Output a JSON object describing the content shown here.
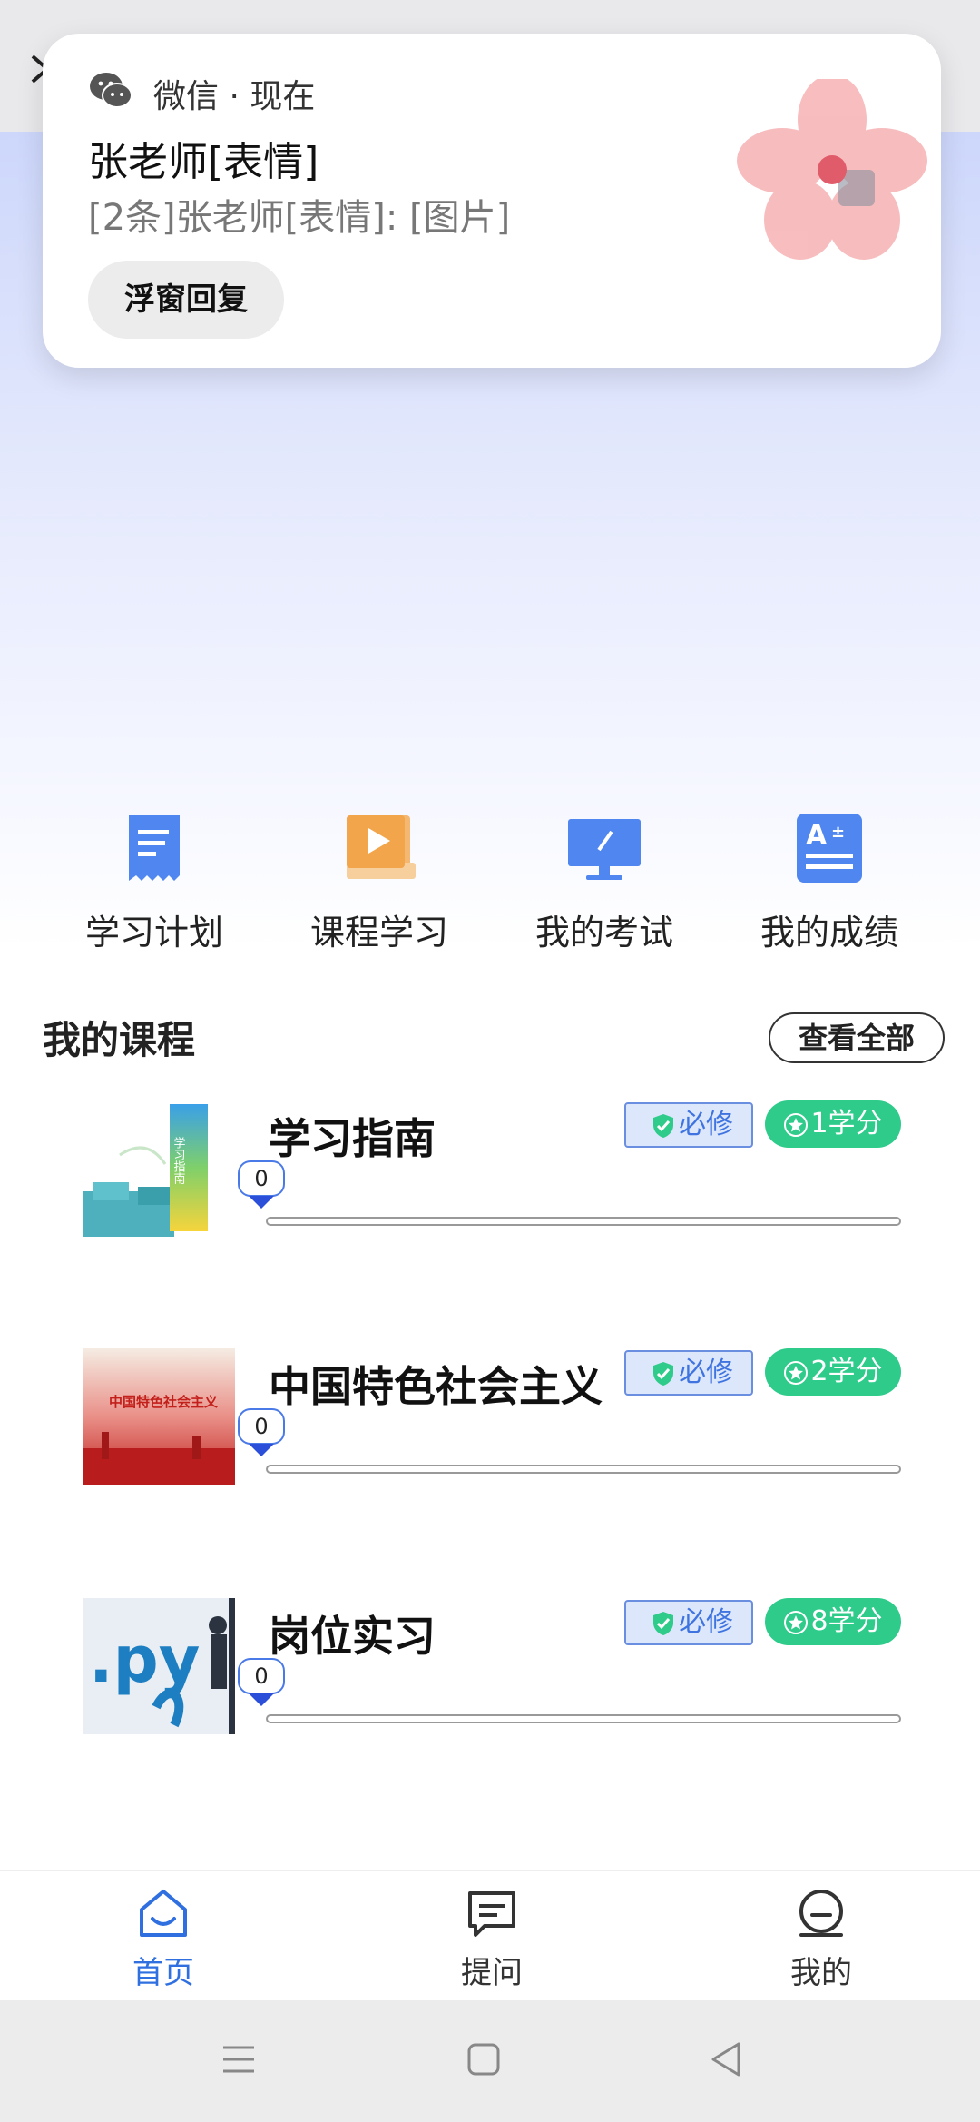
{
  "notification": {
    "app_name": "微信",
    "separator": " · ",
    "time": "现在",
    "title": "张老师[表情]",
    "body": "[2条]张老师[表情]: [图片]",
    "reply_label": "浮窗回复"
  },
  "quick_nav": [
    {
      "label": "学习计划",
      "icon": "document-icon",
      "color": "#4f86f0"
    },
    {
      "label": "课程学习",
      "icon": "book-play-icon",
      "color": "#f2a54a"
    },
    {
      "label": "我的考试",
      "icon": "monitor-edit-icon",
      "color": "#4f86f0"
    },
    {
      "label": "我的成绩",
      "icon": "grade-sheet-icon",
      "color": "#4f86f0"
    }
  ],
  "my_courses": {
    "title": "我的课程",
    "view_all_label": "查看全部"
  },
  "courses": [
    {
      "title": "学习指南",
      "required_label": "必修",
      "credit_label": "1学分",
      "progress_value": "0",
      "progress_percent": 0,
      "thumb_text": "学习指南"
    },
    {
      "title": "中国特色社会主义",
      "required_label": "必修",
      "credit_label": "2学分",
      "progress_value": "0",
      "progress_percent": 0,
      "thumb_text": "中国特色社会主义"
    },
    {
      "title": "岗位实习",
      "required_label": "必修",
      "credit_label": "8学分",
      "progress_value": "0",
      "progress_percent": 0,
      "thumb_text": ".py"
    }
  ],
  "tabbar": {
    "items": [
      {
        "label": "首页",
        "icon": "home-icon",
        "active": true
      },
      {
        "label": "提问",
        "icon": "question-icon",
        "active": false
      },
      {
        "label": "我的",
        "icon": "profile-icon",
        "active": false
      }
    ],
    "active_color": "#2f6fe0",
    "inactive_color": "#333333"
  },
  "colors": {
    "accent": "#4f86f0",
    "credit_green": "#2ecb8a",
    "required_blue": "#3f74e0"
  }
}
